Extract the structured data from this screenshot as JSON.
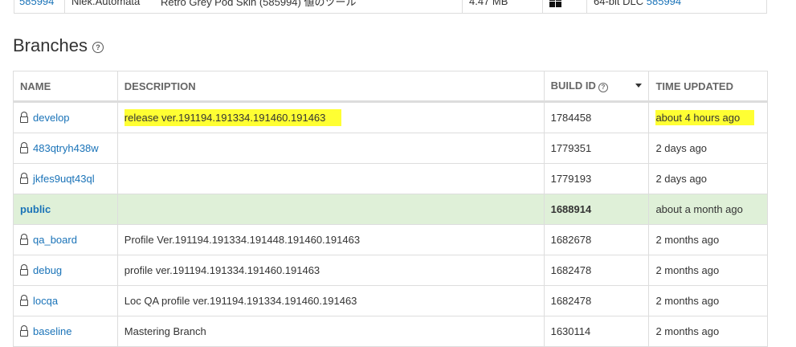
{
  "top_row": {
    "id_link": "585994",
    "user": "Niek.Automata",
    "description": "Retro Grey Pod Skin (585994) 値のツール",
    "size": "4.47 MB",
    "platform_icon": "windows-icon",
    "build_type": "64-bit DLC",
    "build_link": "585994"
  },
  "section": {
    "title": "Branches",
    "help_glyph": "?"
  },
  "table": {
    "headers": {
      "name": "NAME",
      "description": "DESCRIPTION",
      "build_id": "BUILD ID",
      "build_id_help": "?",
      "time_updated": "TIME UPDATED"
    },
    "rows": [
      {
        "name": "develop",
        "locked": true,
        "description": "release ver.191194.191334.191460.191463",
        "build_id": "1784458",
        "time_updated": "about 4 hours ago",
        "highlight": true
      },
      {
        "name": "483qtryh438w",
        "locked": true,
        "description": "",
        "build_id": "1779351",
        "time_updated": "2 days ago"
      },
      {
        "name": "jkfes9uqt43ql",
        "locked": true,
        "description": "",
        "build_id": "1779193",
        "time_updated": "2 days ago"
      },
      {
        "name": "public",
        "locked": false,
        "description": "",
        "build_id": "1688914",
        "time_updated": "about a month ago",
        "is_public": true
      },
      {
        "name": "qa_board",
        "locked": true,
        "description": "Profile Ver.191194.191334.191448.191460.191463",
        "build_id": "1682678",
        "time_updated": "2 months ago"
      },
      {
        "name": "debug",
        "locked": true,
        "description": "profile ver.191194.191334.191460.191463",
        "build_id": "1682478",
        "time_updated": "2 months ago"
      },
      {
        "name": "locqa",
        "locked": true,
        "description": "Loc QA profile ver.191194.191334.191460.191463",
        "build_id": "1682478",
        "time_updated": "2 months ago"
      },
      {
        "name": "baseline",
        "locked": true,
        "description": "Mastering Branch",
        "build_id": "1630114",
        "time_updated": "2 months ago"
      }
    ]
  },
  "colors": {
    "link": "#1a73b8",
    "public_row_bg": "#dff0d8",
    "highlight": "#ffff33",
    "border": "#dddddd"
  }
}
